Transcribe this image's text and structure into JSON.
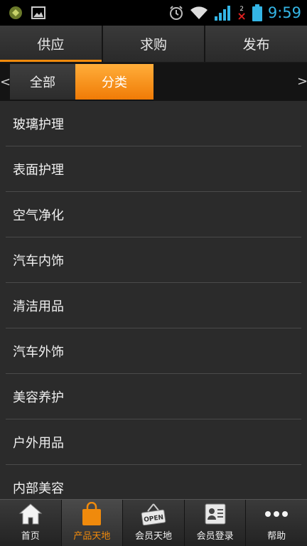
{
  "status_bar": {
    "time": "9:59",
    "notification_count": "2"
  },
  "top_tabs": [
    {
      "label": "供应",
      "active": true
    },
    {
      "label": "求购",
      "active": false
    },
    {
      "label": "发布",
      "active": false
    }
  ],
  "sub_tabs": {
    "left_arrow": "<",
    "right_arrow": ">",
    "all": "全部",
    "category": "分类"
  },
  "list": [
    "玻璃护理",
    "表面护理",
    "空气净化",
    "汽车内饰",
    "清洁用品",
    "汽车外饰",
    "美容养护",
    "户外用品",
    "内部美容"
  ],
  "bottom_nav": [
    {
      "label": "首页",
      "icon": "home-icon"
    },
    {
      "label": "产品天地",
      "icon": "shopping-bag-icon",
      "active": true
    },
    {
      "label": "会员天地",
      "icon": "open-sign-icon"
    },
    {
      "label": "会员登录",
      "icon": "id-card-icon"
    },
    {
      "label": "帮助",
      "icon": "more-dots-icon"
    }
  ],
  "colors": {
    "accent": "#f08a0c",
    "background": "#2b2b2b",
    "status_time": "#34b5e5"
  }
}
